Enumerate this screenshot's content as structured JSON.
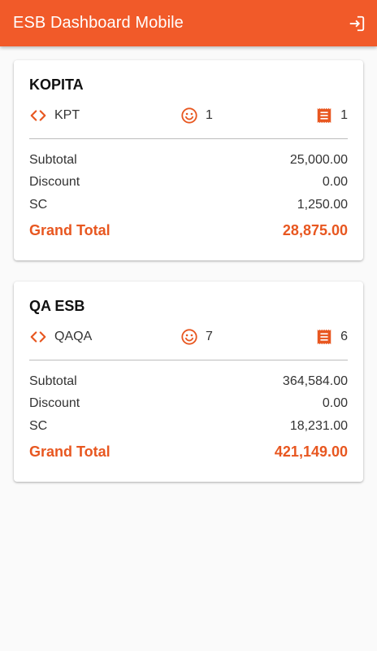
{
  "app": {
    "title": "ESB Dashboard Mobile",
    "accent_color": "#f15a29",
    "logout_icon": "logout-icon"
  },
  "labels": {
    "subtotal": "Subtotal",
    "discount": "Discount",
    "sc": "SC",
    "grand_total": "Grand Total"
  },
  "branches": [
    {
      "name": "KOPITA",
      "code": "KPT",
      "guests": "1",
      "bills": "1",
      "subtotal": "25,000.00",
      "discount": "0.00",
      "sc": "1,250.00",
      "grand_total": "28,875.00"
    },
    {
      "name": "QA ESB",
      "code": "QAQA",
      "guests": "7",
      "bills": "6",
      "subtotal": "364,584.00",
      "discount": "0.00",
      "sc": "18,231.00",
      "grand_total": "421,149.00"
    }
  ],
  "icons": {
    "code": "code-icon",
    "guests": "smiley-icon",
    "bills": "receipt-icon"
  }
}
